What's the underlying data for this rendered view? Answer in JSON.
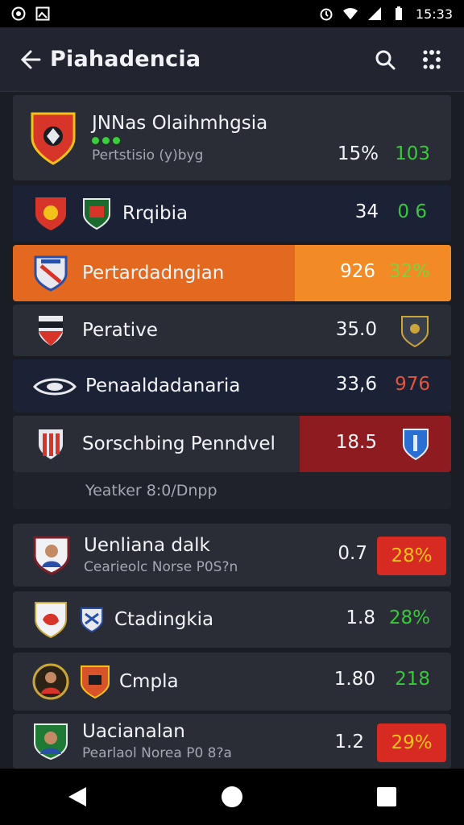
{
  "status_bar": {
    "time": "15:33"
  },
  "app_bar": {
    "title": "Piahadencia"
  },
  "rows": [
    {
      "name": "JNNas Olaihmhgsia",
      "sub": "Pertstisio (y)byg",
      "value": "15%",
      "pct": "103"
    },
    {
      "name": "Rrqibia",
      "value": "34",
      "pct": "0 6"
    },
    {
      "name": "Pertardadngian",
      "value": "926",
      "pct": "32%"
    },
    {
      "name": "Perative",
      "value": "35.0"
    },
    {
      "name": "Penaaldadanaria",
      "value": "33,6",
      "pct": "976"
    },
    {
      "name": "Sorschbing Penndvel",
      "value": "18.5"
    },
    {
      "name": "Yeatker 8:0/Dnpp"
    },
    {
      "name": "Uenliana dalk",
      "sub": "Cearieolc Norse P0S?n",
      "value": "0.7",
      "pct": "28%"
    },
    {
      "name": "Ctadingkia",
      "value": "1.8",
      "pct": "28%"
    },
    {
      "name": "Cmpla",
      "value": "1.80",
      "pct": "218"
    },
    {
      "name": "Uacianalan",
      "sub": "Pearlaol Norea P0 8?a",
      "value": "1.2",
      "pct": "29%"
    }
  ],
  "colors": {
    "accent_orange": "#e2691f",
    "positive_green": "#36c93b",
    "negative_red": "#d72a22",
    "highlight_dark_red": "#8e1b1f"
  }
}
